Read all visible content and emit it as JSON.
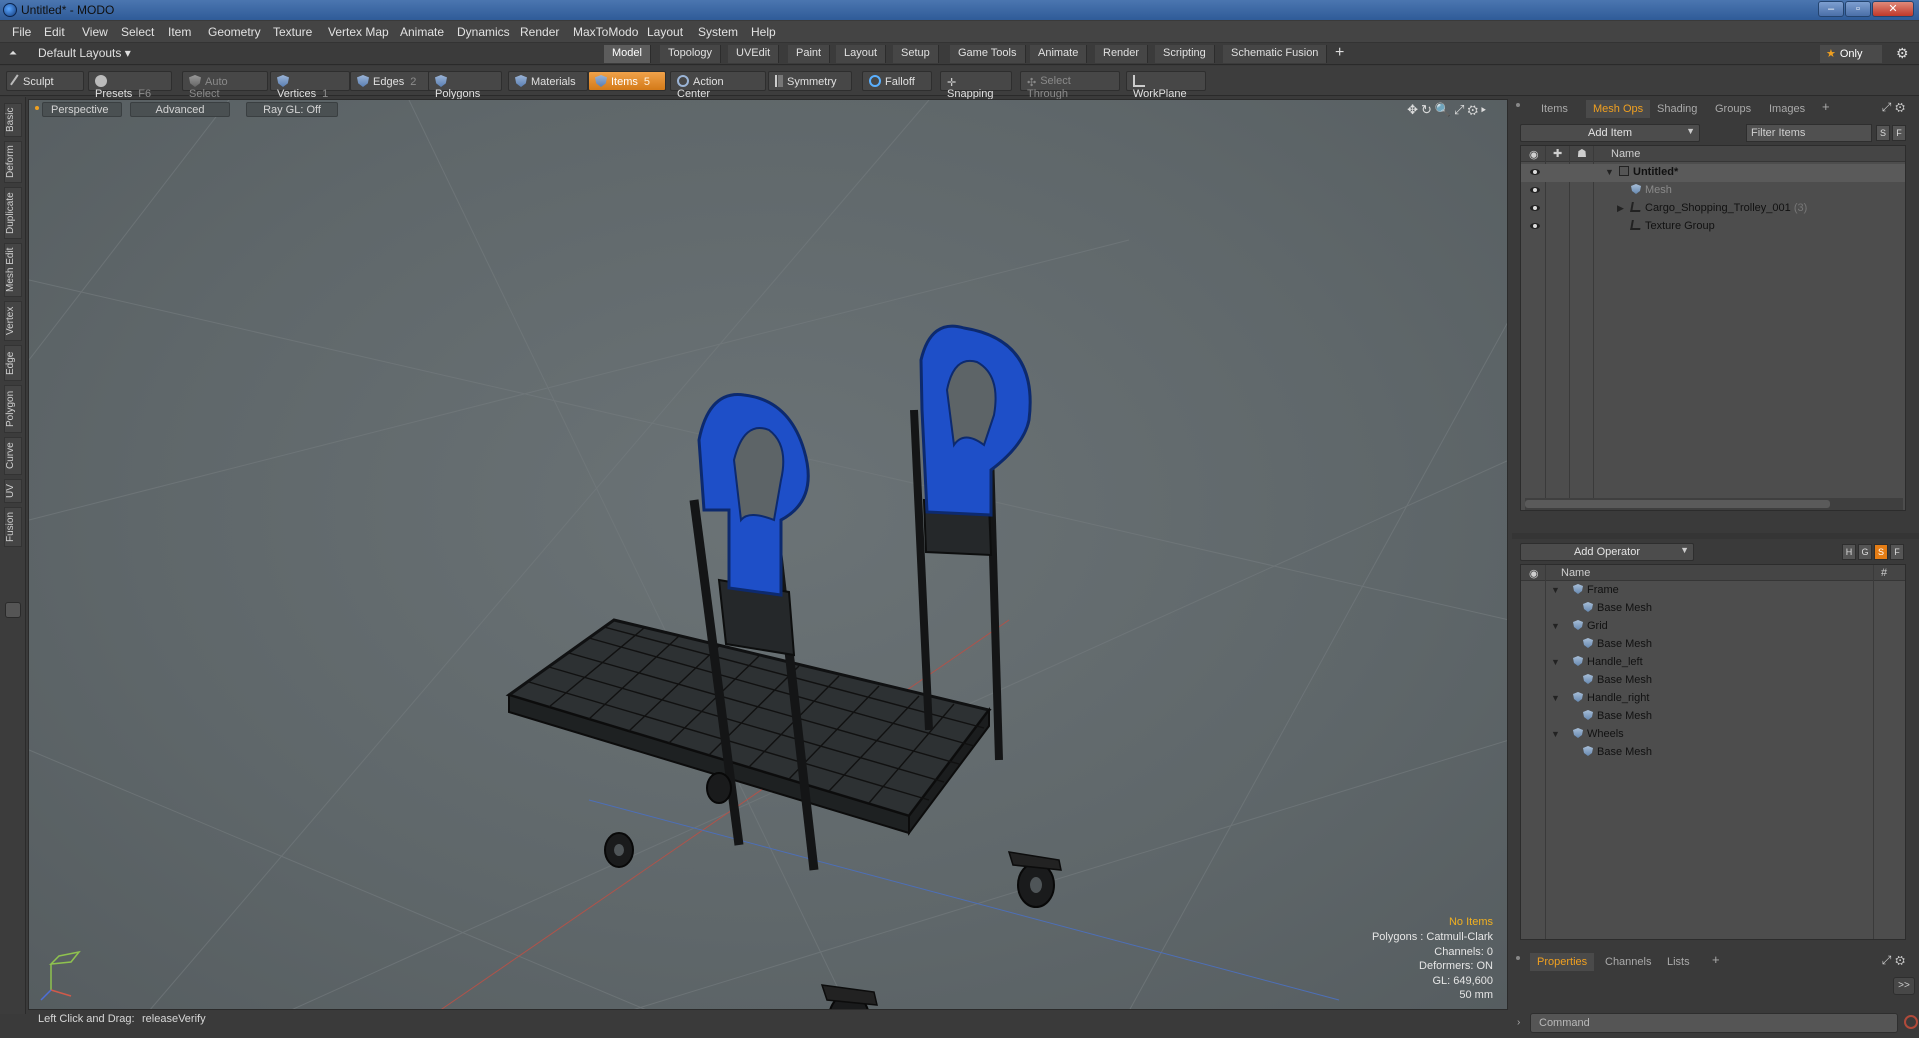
{
  "window": {
    "title": "Untitled* - MODO",
    "buttons": [
      "–",
      "▫",
      "✕"
    ]
  },
  "menu": [
    "File",
    "Edit",
    "View",
    "Select",
    "Item",
    "Geometry",
    "Texture",
    "Vertex Map",
    "Animate",
    "Dynamics",
    "Render",
    "MaxToModo",
    "Layout",
    "System",
    "Help"
  ],
  "layout": {
    "select": "Default Layouts ▾"
  },
  "tabs": [
    "Model",
    "Topology",
    "UVEdit",
    "Paint",
    "Layout",
    "Setup",
    "Game Tools",
    "Animate",
    "Render",
    "Scripting",
    "Schematic Fusion"
  ],
  "tabs_plus": "+",
  "only_label": "Only",
  "toolbar": {
    "sculpt": "Sculpt",
    "presets": "Presets",
    "presets_key": "F6",
    "auto_select": "Auto Select",
    "vertices": "Vertices",
    "vertices_key": "1",
    "edges": "Edges",
    "edges_key": "2",
    "polygons": "Polygons",
    "materials": "Materials",
    "items": "Items",
    "items_key": "5",
    "action_center": "Action Center",
    "symmetry": "Symmetry",
    "falloff": "Falloff",
    "snapping": "Snapping",
    "select_through": "Select Through",
    "workplane": "WorkPlane"
  },
  "left_tabs": [
    "Basic",
    "Deform",
    "Duplicate",
    "Mesh Edit",
    "Vertex",
    "Edge",
    "Polygon",
    "Curve",
    "UV",
    "Fusion"
  ],
  "viewport": {
    "view": "Perspective",
    "mode": "Advanced",
    "raygl": "Ray GL: Off",
    "info": {
      "items": "No Items",
      "polygons": "Polygons : Catmull-Clark",
      "channels": "Channels: 0",
      "deformers": "Deformers: ON",
      "gl": "GL: 649,600",
      "scale": "50 mm"
    }
  },
  "status": {
    "hint": "Left Click and Drag:",
    "action": "releaseVerify"
  },
  "items_panel": {
    "tabs": [
      "Items",
      "Mesh Ops",
      "Shading",
      "Groups",
      "Images"
    ],
    "active_tab": "Mesh Ops",
    "add_item": "Add Item",
    "filter_placeholder": "Filter Items",
    "s_btn": "S",
    "f_btn": "F",
    "col_name": "Name",
    "tree": [
      {
        "label": "Untitled*",
        "count": ""
      },
      {
        "label": "Mesh",
        "count": ""
      },
      {
        "label": "Cargo_Shopping_Trolley_001",
        "count": "(3)"
      },
      {
        "label": "Texture Group",
        "count": ""
      }
    ]
  },
  "meshops_panel": {
    "add_operator": "Add Operator",
    "btns": [
      "H",
      "G",
      "S",
      "F"
    ],
    "col_name": "Name",
    "col_hash": "#",
    "rows": [
      {
        "label": "Frame",
        "level": 0
      },
      {
        "label": "Base Mesh",
        "level": 1
      },
      {
        "label": "Grid",
        "level": 0
      },
      {
        "label": "Base Mesh",
        "level": 1
      },
      {
        "label": "Handle_left",
        "level": 0
      },
      {
        "label": "Base Mesh",
        "level": 1
      },
      {
        "label": "Handle_right",
        "level": 0
      },
      {
        "label": "Base Mesh",
        "level": 1
      },
      {
        "label": "Wheels",
        "level": 0
      },
      {
        "label": "Base Mesh",
        "level": 1
      }
    ]
  },
  "props_panel": {
    "tabs": [
      "Properties",
      "Channels",
      "Lists"
    ],
    "active_tab": "Properties",
    "expand": ">>",
    "command_placeholder": "Command"
  },
  "colors": {
    "accent": "#f0a020",
    "handle_blue": "#1e4fc8"
  }
}
